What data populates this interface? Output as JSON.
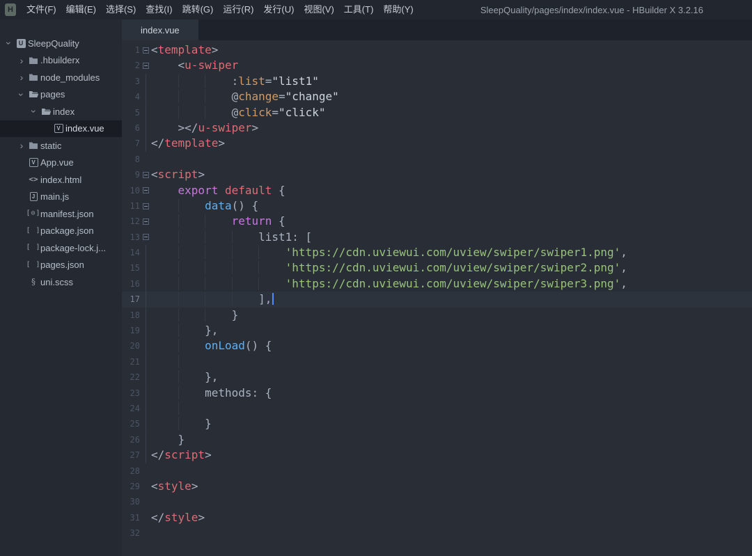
{
  "window": {
    "logo_glyph": "H",
    "title": "SleepQuality/pages/index/index.vue - HBuilder X 3.2.16"
  },
  "menu_bar": {
    "items": [
      {
        "key": "file",
        "label": "文件(F)"
      },
      {
        "key": "edit",
        "label": "编辑(E)"
      },
      {
        "key": "select",
        "label": "选择(S)"
      },
      {
        "key": "find",
        "label": "查找(I)"
      },
      {
        "key": "goto",
        "label": "跳转(G)"
      },
      {
        "key": "run",
        "label": "运行(R)"
      },
      {
        "key": "publish",
        "label": "发行(U)"
      },
      {
        "key": "view",
        "label": "视图(V)"
      },
      {
        "key": "tools",
        "label": "工具(T)"
      },
      {
        "key": "help",
        "label": "帮助(Y)"
      }
    ]
  },
  "file_tree": {
    "items": [
      {
        "key": "sleepquality",
        "label": "SleepQuality",
        "level": 0,
        "chevron": "open",
        "icon": "project"
      },
      {
        "key": "hbuilderx",
        "label": ".hbuilderx",
        "level": 1,
        "chevron": "closed",
        "icon": "folder"
      },
      {
        "key": "node-modules",
        "label": "node_modules",
        "level": 1,
        "chevron": "closed",
        "icon": "folder"
      },
      {
        "key": "pages",
        "label": "pages",
        "level": 1,
        "chevron": "open",
        "icon": "folder-open"
      },
      {
        "key": "index",
        "label": "index",
        "level": 2,
        "chevron": "open",
        "icon": "folder-open"
      },
      {
        "key": "index-vue",
        "label": "index.vue",
        "level": 3,
        "chevron": null,
        "icon": "vue",
        "selected": true
      },
      {
        "key": "static",
        "label": "static",
        "level": 1,
        "chevron": "closed",
        "icon": "folder"
      },
      {
        "key": "app-vue",
        "label": "App.vue",
        "level": 1,
        "chevron": null,
        "icon": "vue"
      },
      {
        "key": "index-html",
        "label": "index.html",
        "level": 1,
        "chevron": null,
        "icon": "html"
      },
      {
        "key": "main-js",
        "label": "main.js",
        "level": 1,
        "chevron": null,
        "icon": "js"
      },
      {
        "key": "manifest-json",
        "label": "manifest.json",
        "level": 1,
        "chevron": null,
        "icon": "manifest"
      },
      {
        "key": "package-json",
        "label": "package.json",
        "level": 1,
        "chevron": null,
        "icon": "json"
      },
      {
        "key": "package-lock",
        "label": "package-lock.j...",
        "level": 1,
        "chevron": null,
        "icon": "json"
      },
      {
        "key": "pages-json",
        "label": "pages.json",
        "level": 1,
        "chevron": null,
        "icon": "json"
      },
      {
        "key": "uni-scss",
        "label": "uni.scss",
        "level": 1,
        "chevron": null,
        "icon": "scss"
      }
    ],
    "icon_glyphs": {
      "project": "U",
      "vue": "V",
      "html": "<>",
      "js": "J",
      "manifest": "[⊙]",
      "json": "[ ]",
      "scss": "§"
    }
  },
  "tab_bar": {
    "tabs": [
      {
        "key": "index-vue",
        "label": "index.vue",
        "active": true
      }
    ]
  },
  "editor": {
    "cursor_line": 17,
    "lines": [
      {
        "n": 1,
        "ind": 0,
        "fold": true,
        "tokens": [
          [
            "p",
            "<"
          ],
          [
            "tag",
            "template"
          ],
          [
            "p",
            ">"
          ]
        ]
      },
      {
        "n": 2,
        "ind": 4,
        "fold": true,
        "tokens": [
          [
            "p",
            "<"
          ],
          [
            "tag",
            "u-swiper"
          ]
        ]
      },
      {
        "n": 3,
        "ind": 12,
        "gl": true,
        "tokens": [
          [
            "p",
            ":"
          ],
          [
            "attr",
            "list"
          ],
          [
            "p",
            "="
          ],
          [
            "val",
            "\"list1\""
          ]
        ]
      },
      {
        "n": 4,
        "ind": 12,
        "gl": true,
        "tokens": [
          [
            "p",
            "@"
          ],
          [
            "attr",
            "change"
          ],
          [
            "p",
            "="
          ],
          [
            "val",
            "\"change\""
          ]
        ]
      },
      {
        "n": 5,
        "ind": 12,
        "gl": true,
        "tokens": [
          [
            "p",
            "@"
          ],
          [
            "attr",
            "click"
          ],
          [
            "p",
            "="
          ],
          [
            "val",
            "\"click\""
          ]
        ]
      },
      {
        "n": 6,
        "ind": 4,
        "gl": true,
        "tokens": [
          [
            "p",
            "></"
          ],
          [
            "tag",
            "u-swiper"
          ],
          [
            "p",
            ">"
          ]
        ]
      },
      {
        "n": 7,
        "ind": 0,
        "gl": true,
        "tokens": [
          [
            "p",
            "</"
          ],
          [
            "tag",
            "template"
          ],
          [
            "p",
            ">"
          ]
        ]
      },
      {
        "n": 8,
        "ind": 0,
        "tokens": []
      },
      {
        "n": 9,
        "ind": 0,
        "fold": true,
        "tokens": [
          [
            "p",
            "<"
          ],
          [
            "tag",
            "script"
          ],
          [
            "p",
            ">"
          ]
        ]
      },
      {
        "n": 10,
        "ind": 4,
        "fold": true,
        "tokens": [
          [
            "kw",
            "export"
          ],
          [
            "plain",
            " "
          ],
          [
            "red",
            "default"
          ],
          [
            "plain",
            " {"
          ]
        ]
      },
      {
        "n": 11,
        "ind": 8,
        "fold": true,
        "tokens": [
          [
            "fn",
            "data"
          ],
          [
            "plain",
            "() {"
          ]
        ]
      },
      {
        "n": 12,
        "ind": 12,
        "fold": true,
        "tokens": [
          [
            "kw",
            "return"
          ],
          [
            "plain",
            " {"
          ]
        ]
      },
      {
        "n": 13,
        "ind": 16,
        "fold": true,
        "tokens": [
          [
            "plain",
            "list1: ["
          ]
        ]
      },
      {
        "n": 14,
        "ind": 20,
        "gl": true,
        "tokens": [
          [
            "str",
            "'https://cdn.uviewui.com/uview/swiper/swiper1.png'"
          ],
          [
            "plain",
            ","
          ]
        ]
      },
      {
        "n": 15,
        "ind": 20,
        "gl": true,
        "tokens": [
          [
            "str",
            "'https://cdn.uviewui.com/uview/swiper/swiper2.png'"
          ],
          [
            "plain",
            ","
          ]
        ]
      },
      {
        "n": 16,
        "ind": 20,
        "gl": true,
        "tokens": [
          [
            "str",
            "'https://cdn.uviewui.com/uview/swiper/swiper3.png'"
          ],
          [
            "plain",
            ","
          ]
        ]
      },
      {
        "n": 17,
        "ind": 16,
        "gl": true,
        "cur": true,
        "caret": true,
        "tokens": [
          [
            "plain",
            "],"
          ]
        ]
      },
      {
        "n": 18,
        "ind": 12,
        "gl": true,
        "tokens": [
          [
            "plain",
            "}"
          ]
        ]
      },
      {
        "n": 19,
        "ind": 8,
        "gl": true,
        "tokens": [
          [
            "plain",
            "},"
          ]
        ]
      },
      {
        "n": 20,
        "ind": 8,
        "gl": true,
        "tokens": [
          [
            "fn",
            "onLoad"
          ],
          [
            "plain",
            "() {"
          ]
        ]
      },
      {
        "n": 21,
        "ind": 0,
        "gind": 8,
        "gl": true,
        "tokens": []
      },
      {
        "n": 22,
        "ind": 8,
        "gl": true,
        "tokens": [
          [
            "plain",
            "},"
          ]
        ]
      },
      {
        "n": 23,
        "ind": 8,
        "gl": true,
        "tokens": [
          [
            "plain",
            "methods: {"
          ]
        ]
      },
      {
        "n": 24,
        "ind": 0,
        "gind": 8,
        "gl": true,
        "tokens": []
      },
      {
        "n": 25,
        "ind": 8,
        "gl": true,
        "tokens": [
          [
            "plain",
            "}"
          ]
        ]
      },
      {
        "n": 26,
        "ind": 4,
        "gl": true,
        "tokens": [
          [
            "plain",
            "}"
          ]
        ]
      },
      {
        "n": 27,
        "ind": 0,
        "gl": true,
        "tokens": [
          [
            "p",
            "</"
          ],
          [
            "tag",
            "script"
          ],
          [
            "p",
            ">"
          ]
        ]
      },
      {
        "n": 28,
        "ind": 0,
        "tokens": []
      },
      {
        "n": 29,
        "ind": 0,
        "tokens": [
          [
            "p",
            "<"
          ],
          [
            "tag",
            "style"
          ],
          [
            "p",
            ">"
          ]
        ]
      },
      {
        "n": 30,
        "ind": 0,
        "tokens": []
      },
      {
        "n": 31,
        "ind": 0,
        "tokens": [
          [
            "p",
            "</"
          ],
          [
            "tag",
            "style"
          ],
          [
            "p",
            ">"
          ]
        ]
      },
      {
        "n": 32,
        "ind": 0,
        "tokens": []
      }
    ]
  },
  "colors": {
    "bg_titlebar": "#22262e",
    "bg_tabbar": "#1e222a",
    "bg_active_tab": "#2c323c",
    "bg_sidebar": "#252a32",
    "bg_editor": "#282d36",
    "bg_selected_row": "#191d23",
    "bg_current_line": "#2d333d",
    "line_number": "#4d5565",
    "punct": "#abb2bf",
    "tag": "#e06c75",
    "attr": "#d19a66",
    "attr_value": "#ced4de",
    "keyword": "#c678dd",
    "keyword2": "#e06c75",
    "function": "#61afef",
    "string": "#98c379",
    "cursor": "#528bff"
  }
}
